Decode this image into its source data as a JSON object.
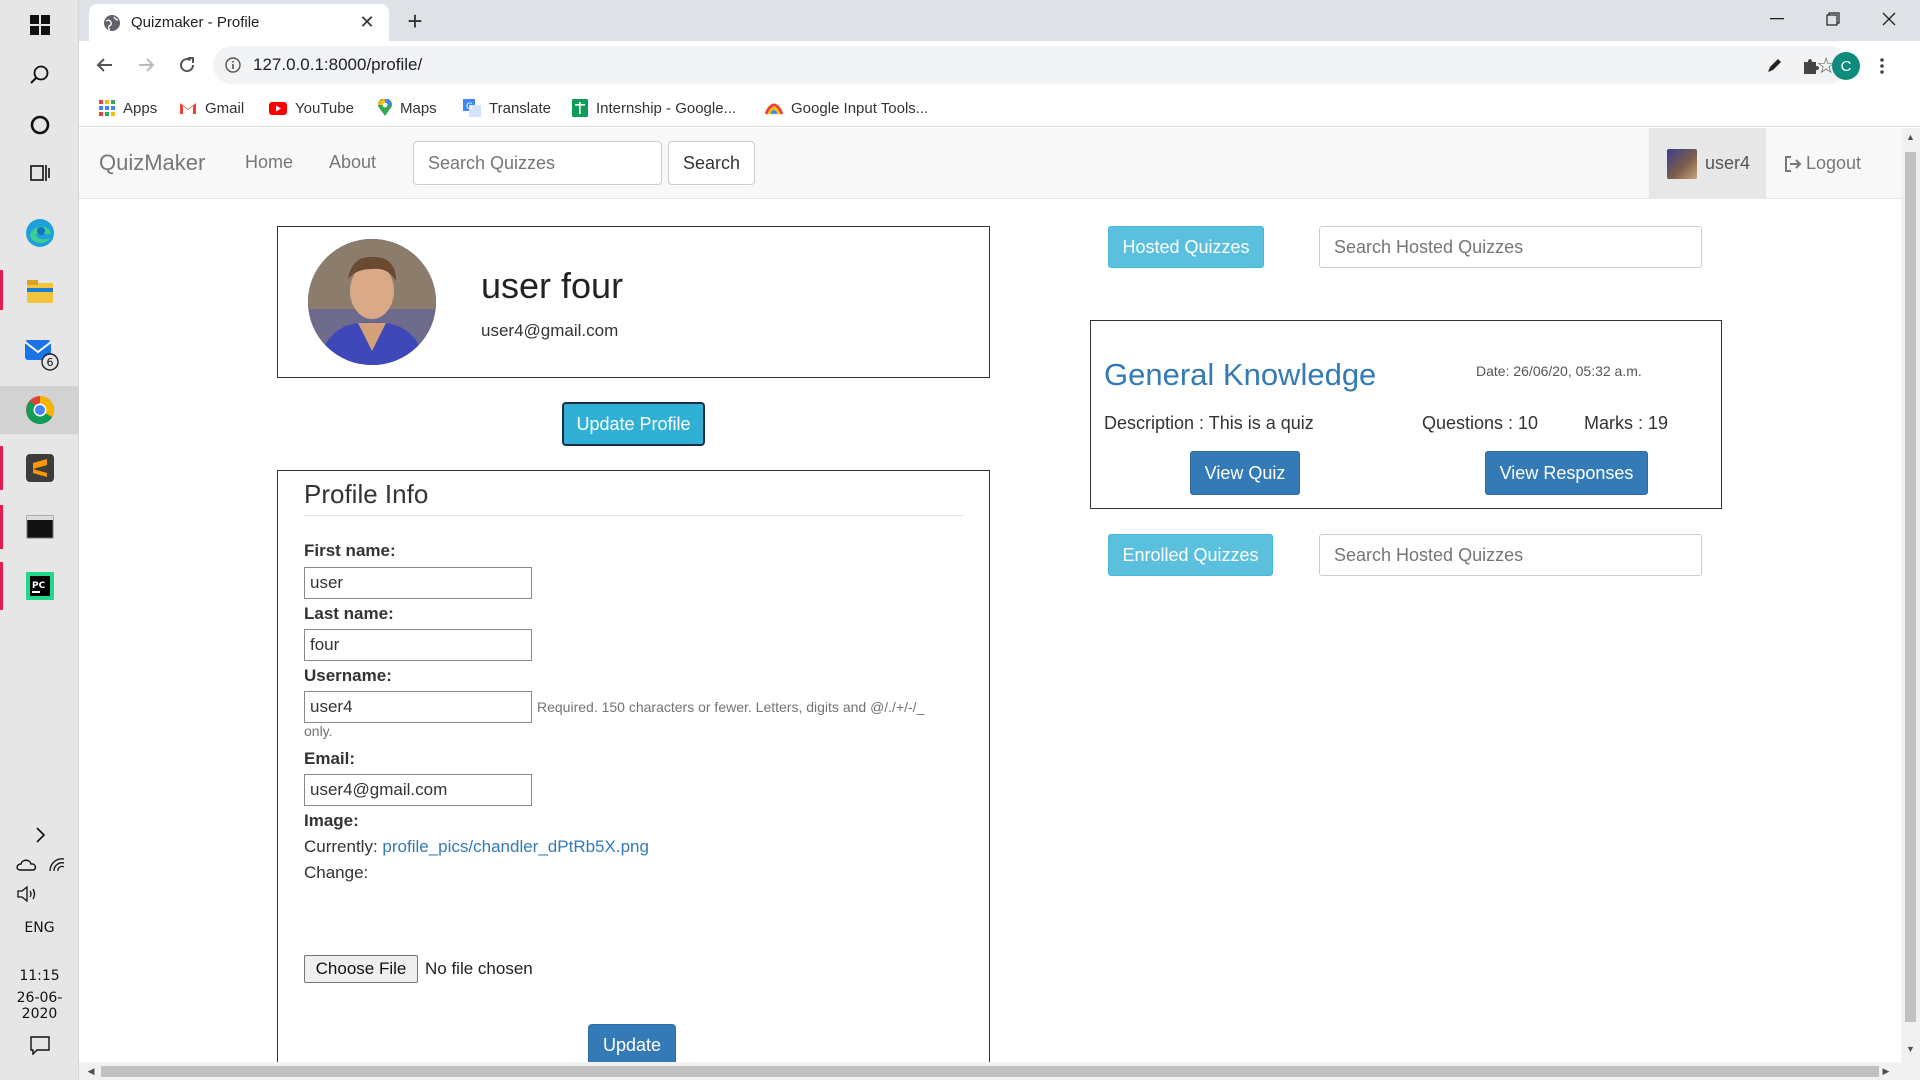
{
  "taskbar": {
    "language": "ENG",
    "time": "11:15",
    "date": "26-06-2020",
    "mail_badge": "6"
  },
  "browser": {
    "tab_title": "Quizmaker - Profile",
    "url": "127.0.0.1:8000/profile/",
    "profile_initial": "C",
    "bookmarks": [
      {
        "label": "Apps"
      },
      {
        "label": "Gmail"
      },
      {
        "label": "YouTube"
      },
      {
        "label": "Maps"
      },
      {
        "label": "Translate"
      },
      {
        "label": "Internship - Google..."
      },
      {
        "label": "Google Input Tools..."
      }
    ]
  },
  "navbar": {
    "brand": "QuizMaker",
    "home": "Home",
    "about": "About",
    "search_placeholder": "Search Quizzes",
    "search_button": "Search",
    "username": "user4",
    "logout": "Logout"
  },
  "profile": {
    "full_name": "user four",
    "email": "user4@gmail.com",
    "update_profile_button": "Update Profile"
  },
  "form": {
    "title": "Profile Info",
    "first_name_label": "First name:",
    "first_name_value": "user",
    "last_name_label": "Last name:",
    "last_name_value": "four",
    "username_label": "Username:",
    "username_value": "user4",
    "username_help_1": "Required. 150 characters or fewer. Letters, digits and @/./+/-/_",
    "username_help_2": "only.",
    "email_label": "Email:",
    "email_value": "user4@gmail.com",
    "image_label": "Image:",
    "currently_label": "Currently:",
    "current_image": "profile_pics/chandler_dPtRb5X.png",
    "change_label": "Change:",
    "choose_file": "Choose File",
    "no_file": "No file chosen",
    "update_button": "Update"
  },
  "hosted": {
    "button": "Hosted Quizzes",
    "search_placeholder": "Search Hosted Quizzes",
    "quiz": {
      "name": "General Knowledge",
      "date": "Date: 26/06/20, 05:32 a.m.",
      "description": "Description : This is a quiz",
      "questions": "Questions : 10",
      "marks": "Marks : 19",
      "view_quiz": "View Quiz",
      "view_responses": "View Responses"
    }
  },
  "enrolled": {
    "button": "Enrolled Quizzes",
    "search_placeholder": "Search Hosted Quizzes"
  },
  "colors": {
    "primary": "#337ab7",
    "info": "#5bc0de",
    "navbar_bg": "#f8f8f8"
  }
}
